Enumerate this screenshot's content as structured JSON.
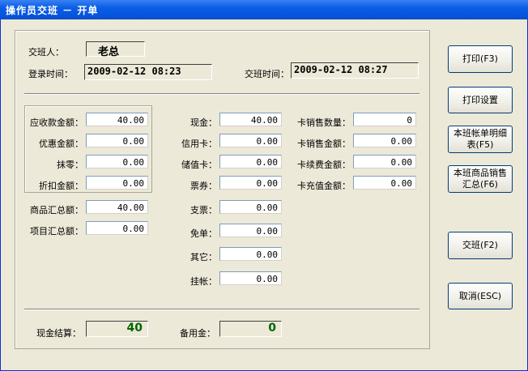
{
  "window": {
    "title": "操作员交班 － 开单"
  },
  "header": {
    "handover_person_label": "交班人：",
    "handover_person_value": "老总",
    "login_time_label": "登录时间：",
    "login_time_value": "2009-02-12 08:23",
    "handover_time_label": "交班时间：",
    "handover_time_value": "2009-02-12 08:27"
  },
  "left": {
    "receivable_label": "应收款金额：",
    "receivable_value": "40.00",
    "discount_amount_label": "优惠金额：",
    "discount_amount_value": "0.00",
    "rounding_label": "抹零：",
    "rounding_value": "0.00",
    "rebate_label": "折扣金额：",
    "rebate_value": "0.00",
    "goods_total_label": "商品汇总额：",
    "goods_total_value": "40.00",
    "items_total_label": "项目汇总额：",
    "items_total_value": "0.00"
  },
  "middle": {
    "cash_label": "现金：",
    "cash_value": "40.00",
    "credit_card_label": "信用卡：",
    "credit_card_value": "0.00",
    "stored_card_label": "储值卡：",
    "stored_card_value": "0.00",
    "voucher_label": "票券：",
    "voucher_value": "0.00",
    "check_label": "支票：",
    "check_value": "0.00",
    "free_label": "免单：",
    "free_value": "0.00",
    "other_label": "其它：",
    "other_value": "0.00",
    "on_account_label": "挂帐：",
    "on_account_value": "0.00"
  },
  "right": {
    "card_sales_qty_label": "卡销售数量：",
    "card_sales_qty_value": "0",
    "card_sales_amount_label": "卡销售金额：",
    "card_sales_amount_value": "0.00",
    "card_renewal_label": "卡续费金额：",
    "card_renewal_value": "0.00",
    "card_recharge_label": "卡充值金额：",
    "card_recharge_value": "0.00"
  },
  "footer": {
    "cash_settlement_label": "现金结算：",
    "cash_settlement_value": "40",
    "reserve_label": "备用金：",
    "reserve_value": "0"
  },
  "buttons": {
    "print": "打印(F3)",
    "print_settings": "打印设置",
    "shift_detail_line1": "本班帐单明细",
    "shift_detail_line2": "表(F5)",
    "shift_goods_line1": "本班商品销售",
    "shift_goods_line2": "汇总(F6)",
    "handover": "交班(F2)",
    "cancel": "取消(ESC)"
  },
  "colors": {
    "title_bar": "#0a5de6",
    "window_bg": "#ece9d8",
    "total_text": "#006600"
  }
}
